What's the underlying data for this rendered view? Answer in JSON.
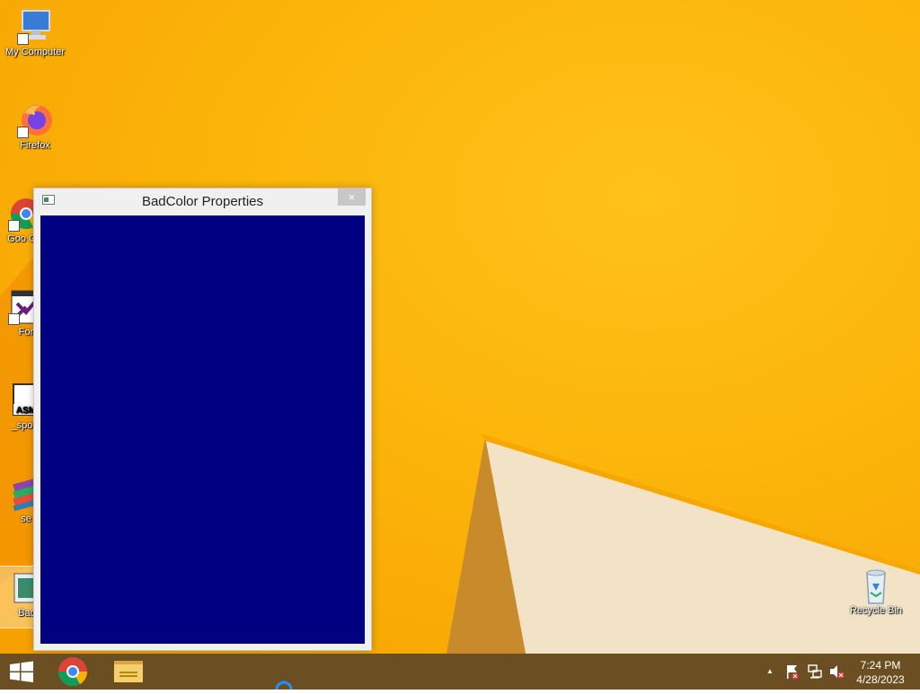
{
  "desktop": {
    "background_color": "#fbb40a",
    "icons": [
      {
        "label": "My Computer",
        "icon": "computer-icon"
      },
      {
        "label": "Firefox",
        "icon": "firefox-icon"
      },
      {
        "label": "Goo Chr",
        "icon": "chrome-icon"
      },
      {
        "label": "For",
        "icon": "visual-studio-icon"
      },
      {
        "label": "_spoof",
        "icon": "asm-file-icon"
      },
      {
        "label": "se",
        "icon": "winrar-icon"
      },
      {
        "label": "Bad",
        "icon": "badcolor-icon"
      },
      {
        "label": "Recycle Bin",
        "icon": "recycle-bin-icon"
      }
    ]
  },
  "window": {
    "title": "BadColor Properties",
    "close_label": "×",
    "client_color": "#000080"
  },
  "taskbar": {
    "background_color": "#6b4f22",
    "items": [
      {
        "name": "start",
        "icon": "windows-logo-icon"
      },
      {
        "name": "chrome",
        "icon": "chrome-icon"
      },
      {
        "name": "file-explorer",
        "icon": "folder-icon"
      }
    ],
    "tray": {
      "chevron": "▲",
      "icons": [
        "action-center-flag-icon",
        "network-icon",
        "volume-muted-icon"
      ]
    },
    "clock": {
      "time": "7:24 PM",
      "date": "4/28/2023"
    }
  }
}
